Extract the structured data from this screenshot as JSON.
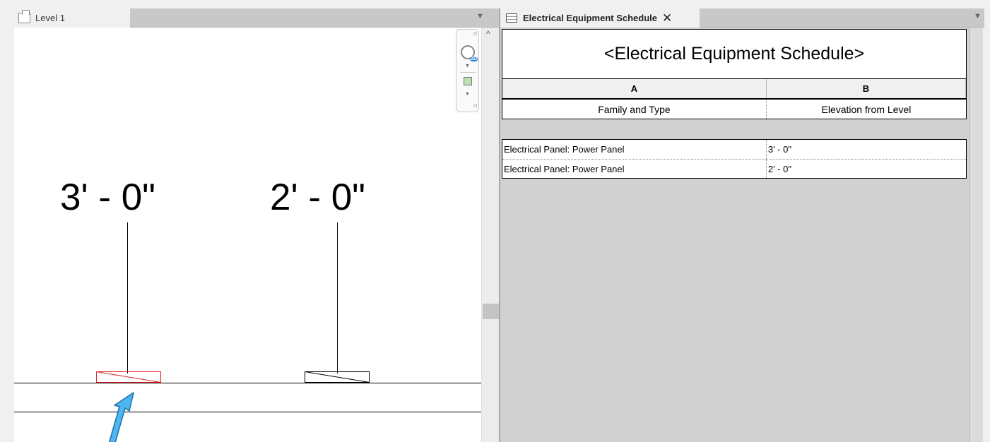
{
  "left_view": {
    "tab_label": "Level 1",
    "dimension_labels": [
      "3' - 0\"",
      "2' - 0\""
    ],
    "selected_panel_color": "#e02020",
    "arrow_color": "#4db6f0"
  },
  "right_view": {
    "tab_label": "Electrical Equipment Schedule",
    "close_glyph": "✕",
    "schedule": {
      "title": "<Electrical Equipment Schedule>",
      "column_letters": [
        "A",
        "B"
      ],
      "column_headers": [
        "Family and Type",
        "Elevation from Level"
      ],
      "rows": [
        {
          "family_and_type": "Electrical Panel: Power Panel",
          "elevation": "3' - 0\""
        },
        {
          "family_and_type": "Electrical Panel: Power Panel",
          "elevation": "2' - 0\""
        }
      ]
    }
  },
  "icons": {
    "view_tab": "floor-plan-icon",
    "schedule_tab": "schedule-table-icon",
    "menu": "menu-dropdown-icon",
    "nav_wheel": "2d-navigation-wheel-icon",
    "zoom": "zoom-region-icon",
    "scroll_up": "scroll-up-arrow-icon"
  }
}
